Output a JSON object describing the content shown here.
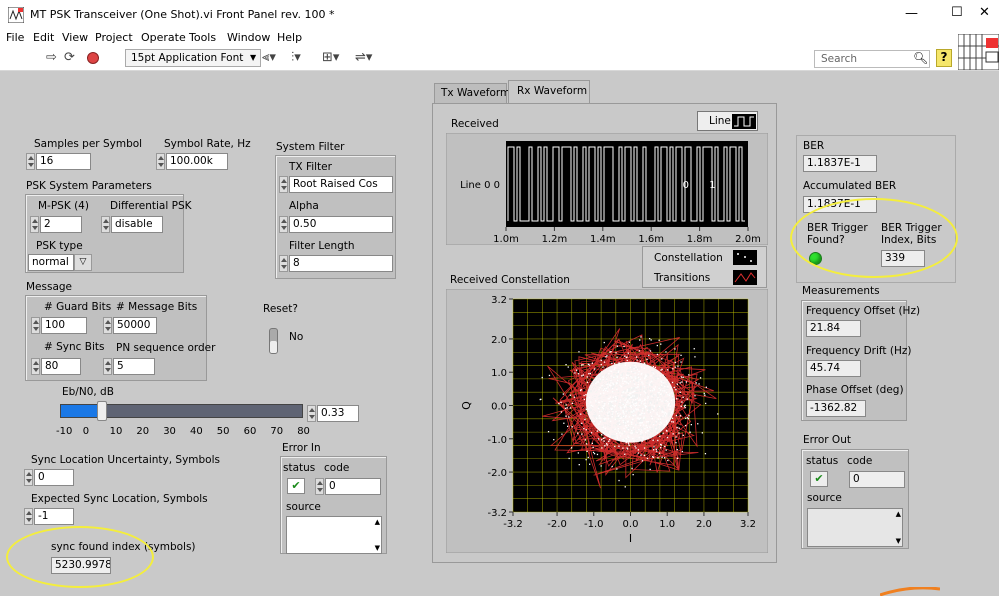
{
  "window": {
    "title": "MT PSK Transceiver (One Shot).vi Front Panel rev. 100 *",
    "minimize": "—",
    "maximize": "☐",
    "close": "✕"
  },
  "menu": [
    "File",
    "Edit",
    "View",
    "Project",
    "Operate",
    "Tools",
    "Window",
    "Help"
  ],
  "toolbar": {
    "font": "15pt Application Font",
    "search_placeholder": "Search",
    "help": "?"
  },
  "controls": {
    "samples_per_symbol": {
      "label": "Samples per Symbol",
      "value": "16"
    },
    "symbol_rate": {
      "label": "Symbol Rate, Hz",
      "value": "100.00k"
    },
    "psk_params": {
      "label": "PSK System Parameters",
      "mpsk_label": "M-PSK (4)",
      "mpsk_value": "2",
      "diff_label": "Differential PSK",
      "diff_value": "disable",
      "type_label": "PSK type",
      "type_value": "normal"
    },
    "system_filter": {
      "label": "System Filter",
      "tx_label": "TX Filter",
      "tx_value": "Root Raised Cos",
      "alpha_label": "Alpha",
      "alpha_value": "0.50",
      "length_label": "Filter Length",
      "length_value": "8"
    },
    "message": {
      "label": "Message",
      "guard_label": "# Guard Bits",
      "guard_value": "100",
      "msgbits_label": "# Message Bits",
      "msgbits_value": "50000",
      "sync_label": "# Sync Bits",
      "sync_value": "80",
      "pn_label": "PN sequence order",
      "pn_value": "5"
    },
    "reset": {
      "label": "Reset?",
      "state": "No"
    },
    "ebn0": {
      "label": "Eb/N0, dB",
      "value": "0.33",
      "fraction": 0.1694,
      "ticks": [
        "-10",
        "0",
        "10",
        "20",
        "30",
        "40",
        "50",
        "60",
        "70",
        "80"
      ]
    },
    "error_in": {
      "label": "Error In",
      "status_label": "status",
      "code_label": "code",
      "code_value": "0",
      "source_label": "source",
      "status_icon": "✔"
    },
    "sync_uncertainty": {
      "label": "Sync Location Uncertainty, Symbols",
      "value": "0"
    },
    "expected_sync": {
      "label": "Expected Sync Location, Symbols",
      "value": "-1"
    },
    "sync_found": {
      "label": "sync found index (symbols)",
      "value": "5230.9978"
    }
  },
  "tabs": {
    "tx": "Tx Waveform",
    "rx": "Rx Waveform",
    "active": "rx"
  },
  "received": {
    "label": "Received",
    "legend": "Line",
    "ylabel": "Line 0",
    "ytick": "0",
    "digits": [
      "0",
      "1"
    ],
    "xticks": [
      "1.0m",
      "1.2m",
      "1.4m",
      "1.6m",
      "1.8m",
      "2.0m"
    ]
  },
  "constellation": {
    "label": "Received Constellation",
    "legend_constellation": "Constellation",
    "legend_transitions": "Transitions",
    "xlabel": "I",
    "ylabel": "Q",
    "xticks": [
      "-3.2",
      "-2.0",
      "-1.0",
      "0.0",
      "1.0",
      "2.0",
      "3.2"
    ],
    "yticks": [
      "3.2",
      "2.0",
      "1.0",
      "0.0",
      "-1.0",
      "-2.0",
      "-3.2"
    ]
  },
  "indicators": {
    "ber": {
      "label": "BER",
      "value": "1.1837E-1"
    },
    "acc_ber": {
      "label": "Accumulated BER",
      "value": "1.1837E-1"
    },
    "trigger_found": {
      "label": "BER Trigger Found?",
      "state": "on"
    },
    "trigger_index": {
      "label": "BER Trigger Index, Bits",
      "value": "339"
    },
    "measurements": {
      "label": "Measurements",
      "freq_offset_label": "Frequency Offset (Hz)",
      "freq_offset_value": "21.84",
      "freq_drift_label": "Frequency Drift (Hz)",
      "freq_drift_value": "45.74",
      "phase_offset_label": "Phase Offset (deg)",
      "phase_offset_value": "-1362.82"
    },
    "error_out": {
      "label": "Error Out",
      "status_label": "status",
      "code_label": "code",
      "code_value": "0",
      "source_label": "source",
      "status_icon": "✔"
    }
  },
  "colors": {
    "panel": "#c9c9c9",
    "graph_bg": "#000000",
    "grid": "#c8c800",
    "constellation_points": "#ffffff",
    "transitions": "#e03030",
    "led_on": "#2ee02e",
    "annotation": "#f4ee3c",
    "slider": "#1a78e6"
  }
}
